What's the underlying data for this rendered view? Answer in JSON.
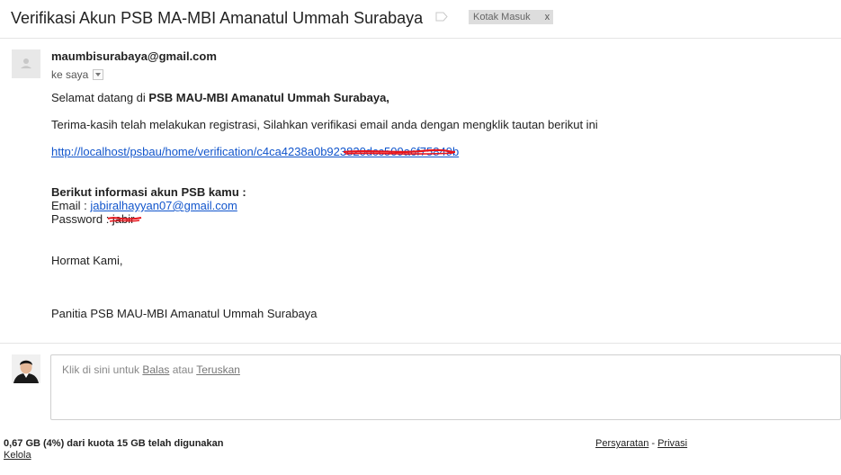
{
  "email": {
    "subject": "Verifikasi Akun PSB MA-MBI Amanatul Ummah Surabaya",
    "label": "Kotak Masuk",
    "label_remove": "x",
    "sender": "maumbisurabaya@gmail.com",
    "to": "ke saya"
  },
  "message": {
    "greeting_prefix": "Selamat datang di ",
    "greeting_org": "PSB MAU-MBI Amanatul Ummah Surabaya,",
    "registration_text": "Terima-kasih telah melakukan registrasi, Silahkan verifikasi email anda dengan mengklik tautan berikut ini",
    "verification_link": "http://localhost/psbau/home/verification/c4ca4238a0b923820dcc509a6f75849b",
    "info_heading": "Berikut informasi akun PSB kamu :",
    "email_label": "Email : ",
    "email_value": "jabiralhayyan07@gmail.com",
    "password_label": "Password : ",
    "password_value": "jabir",
    "closing": "Hormat Kami,",
    "signature": "Panitia PSB MAU-MBI Amanatul Ummah Surabaya"
  },
  "reply": {
    "prefix": "Klik di sini untuk ",
    "reply_link": "Balas",
    "middle": " atau ",
    "forward_link": "Teruskan"
  },
  "footer": {
    "quota": "0,67 GB (4%) dari kuota 15 GB telah digunakan",
    "manage": "Kelola",
    "terms": "Persyaratan",
    "separator": " - ",
    "privacy": "Privasi"
  },
  "colors": {
    "link": "#1155cc",
    "redaction": "#e8141b",
    "label_chip_bg": "#dddddd"
  },
  "icons": {
    "label": "label-outline-icon",
    "sender_avatar": "person-silhouette-icon",
    "my_avatar": "user-photo-icon",
    "recipient_dropdown": "chevron-down-icon"
  }
}
